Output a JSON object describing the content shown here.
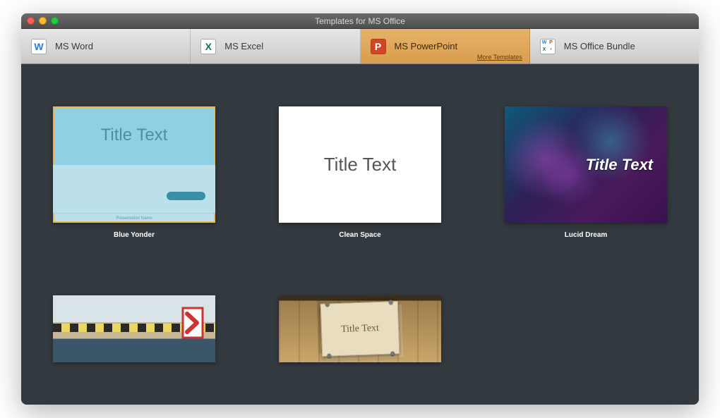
{
  "window": {
    "title": "Templates for MS Office"
  },
  "tabs": [
    {
      "label": "MS Word",
      "icon": "word",
      "letter": "W",
      "active": false
    },
    {
      "label": "MS Excel",
      "icon": "excel",
      "letter": "X",
      "active": false
    },
    {
      "label": "MS PowerPoint",
      "icon": "ppt",
      "letter": "P",
      "active": true,
      "more_link": "More Templates"
    },
    {
      "label": "MS Office Bundle",
      "icon": "bundle",
      "active": false
    }
  ],
  "templates": [
    {
      "name": "Blue Yonder",
      "placeholder": "Title Text",
      "footer": "Presentation Name",
      "selected": true,
      "style": "blue"
    },
    {
      "name": "Clean Space",
      "placeholder": "Title Text",
      "selected": false,
      "style": "clean"
    },
    {
      "name": "Lucid Dream",
      "placeholder": "Title Text",
      "selected": false,
      "style": "lucid"
    }
  ],
  "templates_row2": [
    {
      "name": "",
      "placeholder": "",
      "style": "road"
    },
    {
      "name": "",
      "placeholder": "Title Text",
      "style": "wood"
    }
  ]
}
